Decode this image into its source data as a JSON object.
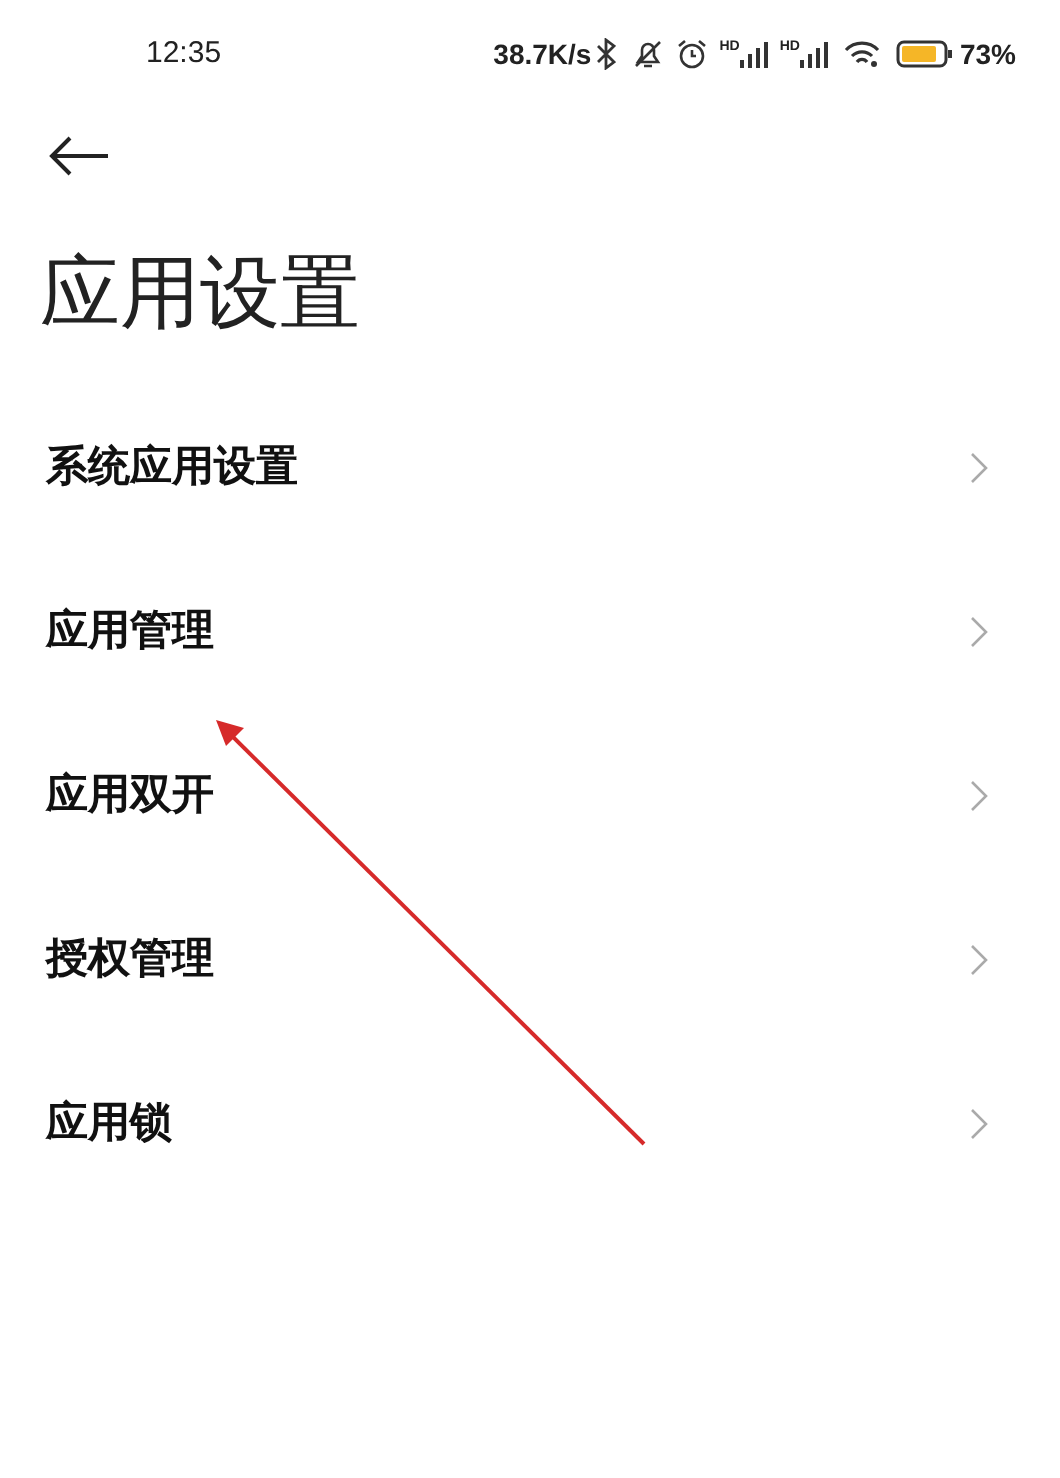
{
  "status_bar": {
    "time": "12:35",
    "speed": "38.7K/s",
    "signal_labels": [
      "HD",
      "HD"
    ],
    "battery_percent": "73%"
  },
  "page": {
    "title": "应用设置"
  },
  "items": [
    {
      "label": "系统应用设置"
    },
    {
      "label": "应用管理"
    },
    {
      "label": "应用双开"
    },
    {
      "label": "授权管理"
    },
    {
      "label": "应用锁"
    }
  ]
}
